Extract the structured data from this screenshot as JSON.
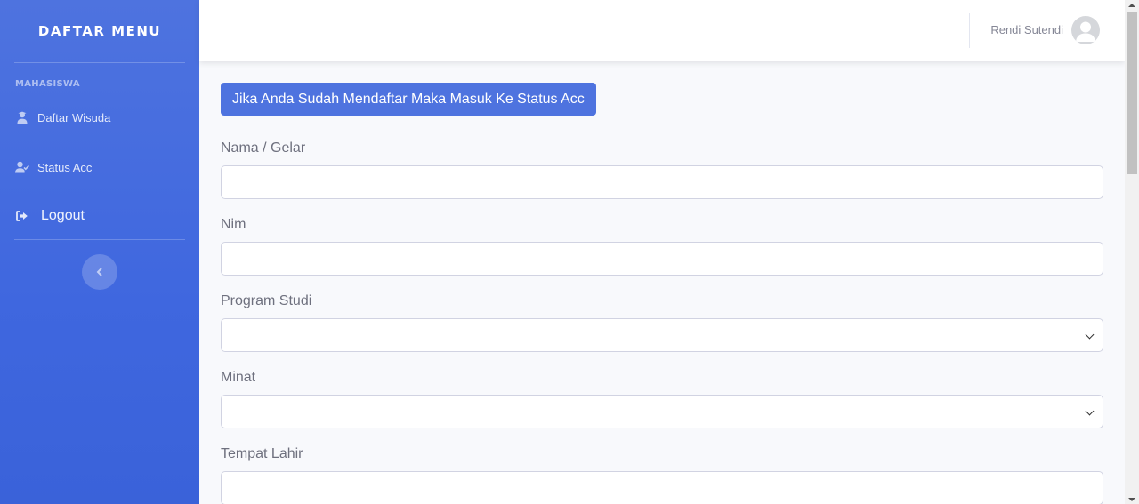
{
  "sidebar": {
    "brand": "DAFTAR MENU",
    "heading": "MAHASISWA",
    "items": [
      {
        "label": "Daftar Wisuda",
        "icon": "graduate-icon"
      },
      {
        "label": "Status Acc",
        "icon": "user-check-icon"
      },
      {
        "label": "Logout",
        "icon": "sign-out-icon"
      }
    ],
    "toggle_icon": "chevron-left-icon"
  },
  "topbar": {
    "user_name": "Rendi Sutendi",
    "avatar_icon": "user-avatar-icon"
  },
  "main": {
    "status_button": "Jika Anda Sudah Mendaftar Maka Masuk Ke Status Acc",
    "fields": [
      {
        "label": "Nama / Gelar",
        "type": "text",
        "value": ""
      },
      {
        "label": "Nim",
        "type": "text",
        "value": ""
      },
      {
        "label": "Program Studi",
        "type": "select",
        "value": ""
      },
      {
        "label": "Minat",
        "type": "select",
        "value": ""
      },
      {
        "label": "Tempat Lahir",
        "type": "text",
        "value": ""
      }
    ]
  },
  "colors": {
    "primary": "#4e73df",
    "sidebar_gradient_end": "#3a62d9",
    "label_text": "#6e707e"
  }
}
